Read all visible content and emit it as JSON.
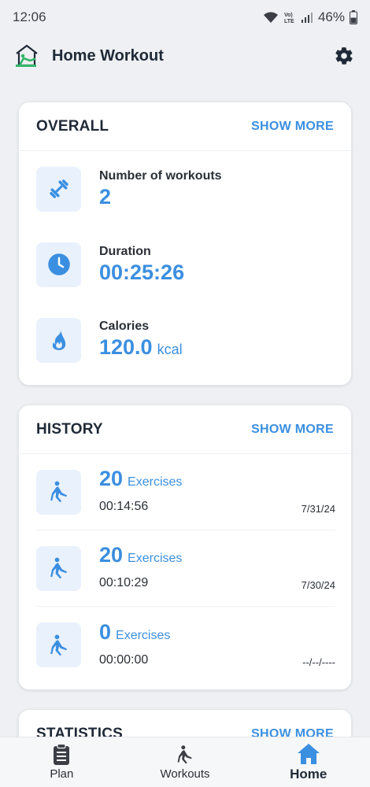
{
  "status_bar": {
    "time": "12:06",
    "battery": "46%"
  },
  "app_bar": {
    "title": "Home Workout",
    "logo_icon": "home-workout-logo",
    "settings_icon": "gear-icon"
  },
  "overall": {
    "title": "OVERALL",
    "show_more": "SHOW MORE",
    "stats": [
      {
        "label": "Number of workouts",
        "value": "2",
        "unit": "",
        "icon": "dumbbell-icon"
      },
      {
        "label": "Duration",
        "value": "00:25:26",
        "unit": "",
        "icon": "clock-icon"
      },
      {
        "label": "Calories",
        "value": "120.0",
        "unit": "kcal",
        "icon": "flame-icon"
      }
    ]
  },
  "history": {
    "title": "HISTORY",
    "show_more": "SHOW MORE",
    "items": [
      {
        "count": "20",
        "exercises_label": "Exercises",
        "duration": "00:14:56",
        "date": "7/31/24"
      },
      {
        "count": "20",
        "exercises_label": "Exercises",
        "duration": "00:10:29",
        "date": "7/30/24"
      },
      {
        "count": "0",
        "exercises_label": "Exercises",
        "duration": "00:00:00",
        "date": "--/--/----"
      }
    ]
  },
  "statistics": {
    "title": "STATISTICS",
    "show_more": "SHOW MORE"
  },
  "bottom_nav": {
    "items": [
      {
        "label": "Plan",
        "icon": "clipboard-icon",
        "active": false
      },
      {
        "label": "Workouts",
        "icon": "stretching-person-icon",
        "active": false
      },
      {
        "label": "Home",
        "icon": "home-icon",
        "active": true
      }
    ]
  },
  "colors": {
    "accent": "#3b8fe0",
    "tile_bg": "#e9f1fd",
    "page_bg": "#eef0f3"
  }
}
